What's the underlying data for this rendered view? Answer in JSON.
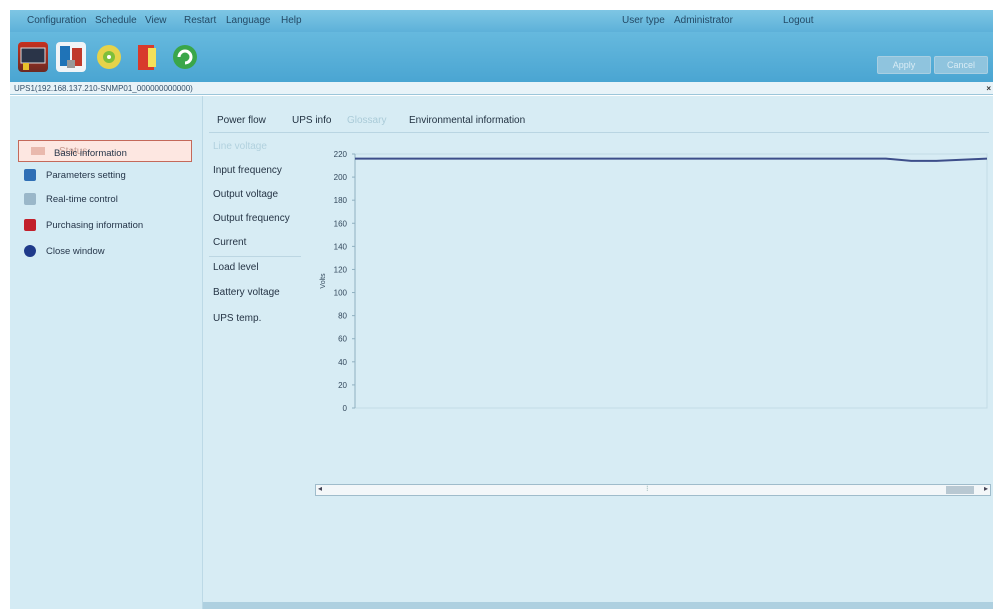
{
  "menubar": {
    "items": [
      "Configuration",
      "Schedule",
      "View",
      "Restart",
      "Language",
      "Help"
    ],
    "user_type_label": "User type",
    "user_type_value": "Administrator",
    "logout": "Logout"
  },
  "toolbar": {
    "icons": [
      "monitor-icon",
      "tools-icon",
      "cd-icon",
      "ups-icon",
      "refresh-icon"
    ],
    "buttons": [
      "Apply",
      "Cancel"
    ]
  },
  "pathbar": {
    "text": "UPS1(192.168.137.210-SNMP01_000000000000)",
    "close": "×"
  },
  "sidebar": {
    "selected": "Status",
    "items": [
      {
        "label": "Basic information",
        "icon": "info-icon",
        "color": "#ffffff"
      },
      {
        "label": "Parameters setting",
        "icon": "monitor-icon",
        "color": "#2f6fb5"
      },
      {
        "label": "Real-time control",
        "icon": "control-icon",
        "color": "#9ab7c9"
      },
      {
        "label": "Purchasing information",
        "icon": "purchase-icon",
        "color": "#c21f2a"
      },
      {
        "label": "Close window",
        "icon": "close-icon",
        "color": "#1f3a8a"
      }
    ]
  },
  "main": {
    "tabs": [
      "Power flow",
      "UPS info",
      "Glossary",
      "Environmental information"
    ],
    "measurements": [
      "Line voltage",
      "Input frequency",
      "Output voltage",
      "Output frequency",
      "Current",
      "Load level",
      "Battery voltage",
      "UPS temp."
    ]
  },
  "chart_data": {
    "type": "line",
    "ylabel": "Volts",
    "yticks": [
      0,
      20,
      40,
      60,
      80,
      100,
      120,
      140,
      160,
      180,
      200,
      220
    ],
    "ylim": [
      0,
      220
    ],
    "series": [
      {
        "values": [
          216,
          216,
          216,
          216,
          216,
          216,
          216,
          216,
          216,
          216,
          216,
          216,
          216,
          216,
          216,
          216,
          216,
          216,
          216,
          216,
          216,
          216,
          214,
          214,
          215,
          216
        ]
      }
    ],
    "colors": {
      "line": "#3d4e8a"
    }
  },
  "scrollbar": {
    "left_arrow": "◂",
    "right_arrow": "▸",
    "center_mark": "⁝"
  }
}
